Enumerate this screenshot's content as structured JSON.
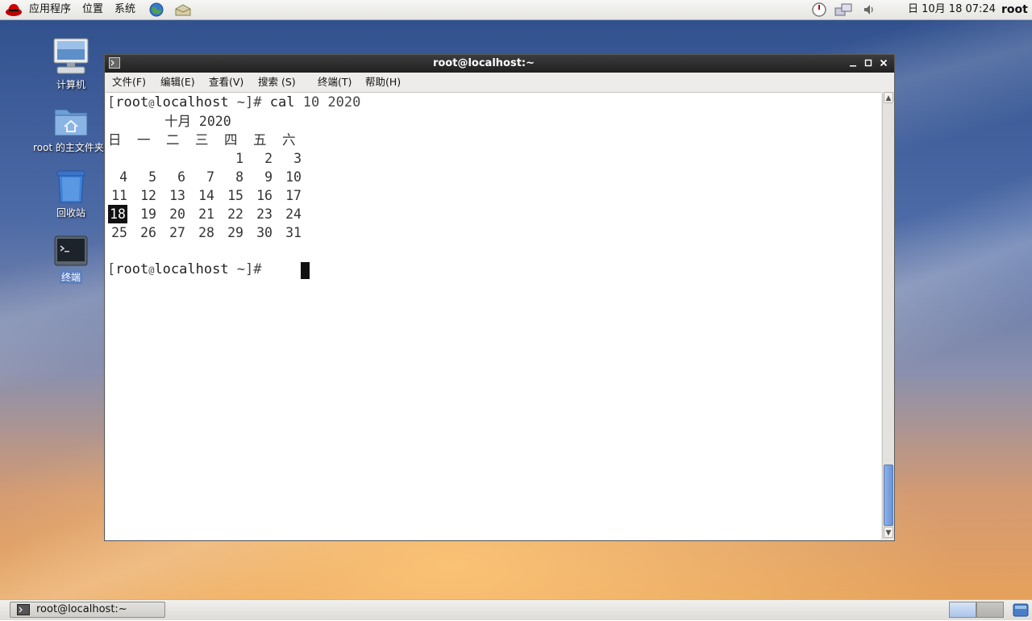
{
  "top_panel": {
    "menus": [
      "应用程序",
      "位置",
      "系统"
    ],
    "datetime": "日 10月 18 07:24",
    "user": "root"
  },
  "desktop_icons": [
    {
      "label": "计算机",
      "icon": "computer-icon"
    },
    {
      "label": "root 的主文件夹",
      "icon": "home-folder-icon"
    },
    {
      "label": "回收站",
      "icon": "trash-icon"
    },
    {
      "label": "终端",
      "icon": "terminal-icon"
    }
  ],
  "terminal": {
    "title": "root@localhost:~",
    "menu": [
      "文件(F)",
      "编辑(E)",
      "查看(V)",
      "搜索 (S)",
      "终端(T)",
      "帮助(H)"
    ],
    "prompt_prefix": "[",
    "prompt_user": "root",
    "prompt_at": "@",
    "prompt_host": "localhost",
    "prompt_suffix": " ~]# ",
    "command": "cal",
    "command_args": " 10 2020",
    "calendar": {
      "title": "十月 2020",
      "weekdays": [
        "日",
        "一",
        "二",
        "三",
        "四",
        "五",
        "六"
      ],
      "weeks": [
        [
          "",
          "",
          "",
          "",
          "1",
          "2",
          "3"
        ],
        [
          "4",
          "5",
          "6",
          "7",
          "8",
          "9",
          "10"
        ],
        [
          "11",
          "12",
          "13",
          "14",
          "15",
          "16",
          "17"
        ],
        [
          "18",
          "19",
          "20",
          "21",
          "22",
          "23",
          "24"
        ],
        [
          "25",
          "26",
          "27",
          "28",
          "29",
          "30",
          "31"
        ]
      ],
      "today": "18"
    }
  },
  "taskbar": {
    "window_label": "root@localhost:~"
  },
  "colors": {
    "titlebar": "#2a2a2a",
    "terminal_bg": "#ffffff",
    "selection": "#5c7fbf"
  }
}
